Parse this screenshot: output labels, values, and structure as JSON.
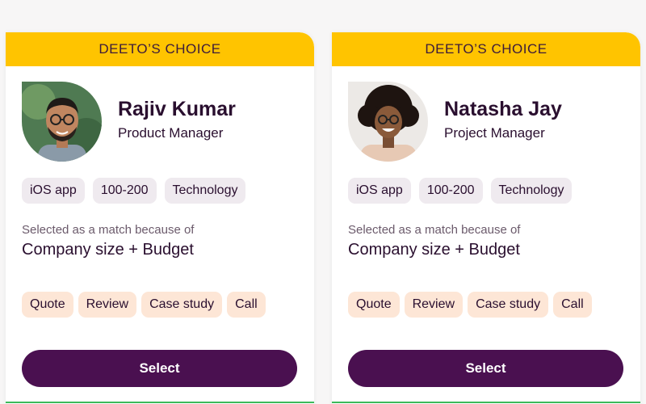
{
  "cards": [
    {
      "banner": "DEETO’S CHOICE",
      "name": "Rajiv Kumar",
      "role": "Product Manager",
      "chips": [
        "iOS app",
        "100-200",
        "Technology"
      ],
      "reason_label": "Selected as a match because of",
      "reason_value": "Company size + Budget",
      "tags": [
        "Quote",
        "Review",
        "Case study",
        "Call"
      ],
      "select_label": "Select"
    },
    {
      "banner": "DEETO’S CHOICE",
      "name": "Natasha Jay",
      "role": "Project Manager",
      "chips": [
        "iOS app",
        "100-200",
        "Technology"
      ],
      "reason_label": "Selected as a match because of",
      "reason_value": "Company size + Budget",
      "tags": [
        "Quote",
        "Review",
        "Case study",
        "Call"
      ],
      "select_label": "Select"
    }
  ],
  "colors": {
    "banner": "#ffc400",
    "primary": "#4a1050",
    "chip_bg": "#efeaef",
    "tag_bg": "#fde6d6",
    "accent_line": "#3cb95a"
  }
}
